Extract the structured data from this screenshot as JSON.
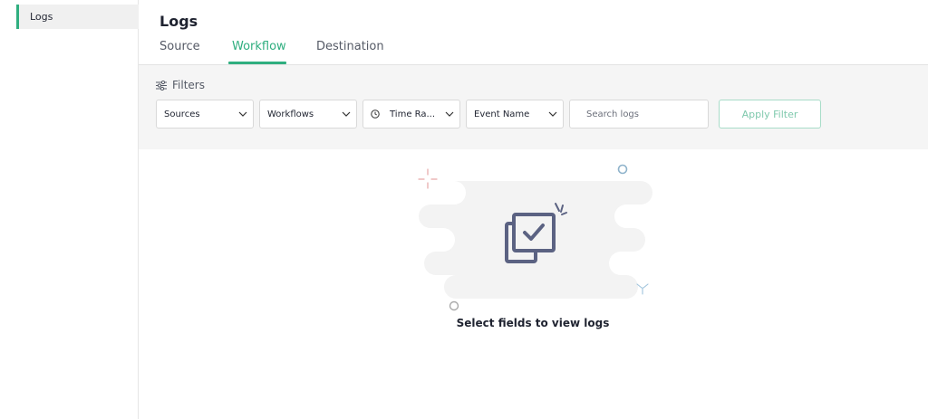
{
  "sidebar": {
    "items": [
      {
        "label": "Logs",
        "active": true
      }
    ]
  },
  "header": {
    "title": "Logs",
    "tabs": [
      {
        "label": "Source",
        "active": false
      },
      {
        "label": "Workflow",
        "active": true
      },
      {
        "label": "Destination",
        "active": false
      }
    ]
  },
  "filters": {
    "heading": "Filters",
    "heading_icon": "sliders-icon",
    "sources": {
      "label": "Sources"
    },
    "workflows": {
      "label": "Workflows"
    },
    "time_range": {
      "label": "Time Ra..."
    },
    "event_name": {
      "label": "Event Name"
    },
    "search": {
      "value": "",
      "placeholder": "Search logs"
    },
    "apply_label": "Apply Filter"
  },
  "empty_state": {
    "message": "Select fields to view logs",
    "icon": "checkbox-stack-icon"
  },
  "colors": {
    "accent": "#2fae7f",
    "accent_light": "#a8dcc8",
    "panel_bg": "#f5f5f5",
    "illustration": "#5b6282"
  }
}
